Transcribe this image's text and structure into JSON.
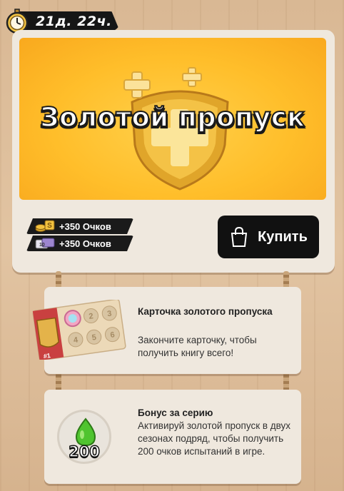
{
  "timer": {
    "text": "21д. 22ч.",
    "icon": "stopwatch-icon"
  },
  "banner": {
    "title": "Золотой пропуск"
  },
  "points": [
    {
      "icon": "gold-coins-icon",
      "label": "+350 Очков"
    },
    {
      "icon": "silver-tickets-icon",
      "label": "+350 Очков"
    }
  ],
  "buy_button": {
    "label": "Купить",
    "icon": "shopping-bag-icon"
  },
  "cards": [
    {
      "title": "Карточка золотого пропуска",
      "description": "Закончите карточку, чтобы получить книгу всего!",
      "icon": "gold-pass-card-icon",
      "tag": "#1",
      "tiles": [
        "2",
        "3",
        "4",
        "5",
        "6"
      ]
    },
    {
      "title": "Бонус за серию",
      "description": "Активируй золотой пропуск в двух сезонах подряд, чтобы получить 200 очков испытаний в игре.",
      "icon": "green-drop-icon",
      "badge_value": "200"
    }
  ],
  "colors": {
    "banner": "#ffbe2a",
    "button": "#111111",
    "card": "#efe8de"
  }
}
